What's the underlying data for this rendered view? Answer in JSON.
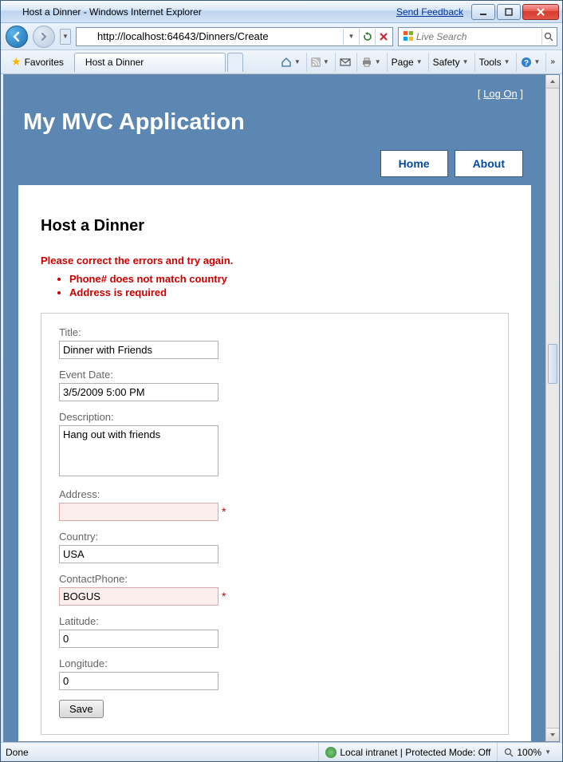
{
  "window": {
    "title": "Host a Dinner - Windows Internet Explorer",
    "feedback": "Send Feedback"
  },
  "address": {
    "url": "http://localhost:64643/Dinners/Create"
  },
  "search": {
    "placeholder": "Live Search"
  },
  "favorites_label": "Favorites",
  "tab_title": "Host a Dinner",
  "cmd": {
    "page": "Page",
    "safety": "Safety",
    "tools": "Tools"
  },
  "page": {
    "logon_prefix": "[ ",
    "logon_link": "Log On",
    "logon_suffix": " ]",
    "app_title": "My MVC Application",
    "nav": {
      "home": "Home",
      "about": "About"
    },
    "heading": "Host a Dinner",
    "validation_heading": "Please correct the errors and try again.",
    "validation_errors": [
      "Phone# does not match country",
      "Address is required"
    ],
    "labels": {
      "title": "Title:",
      "eventdate": "Event Date:",
      "description": "Description:",
      "address": "Address:",
      "country": "Country:",
      "contactphone": "ContactPhone:",
      "latitude": "Latitude:",
      "longitude": "Longitude:"
    },
    "values": {
      "title": "Dinner with Friends",
      "eventdate": "3/5/2009 5:00 PM",
      "description": "Hang out with friends",
      "address": "",
      "country": "USA",
      "contactphone": "BOGUS",
      "latitude": "0",
      "longitude": "0"
    },
    "asterisk": "*",
    "save": "Save"
  },
  "status": {
    "done": "Done",
    "zone": "Local intranet | Protected Mode: Off",
    "zoom": "100%"
  }
}
